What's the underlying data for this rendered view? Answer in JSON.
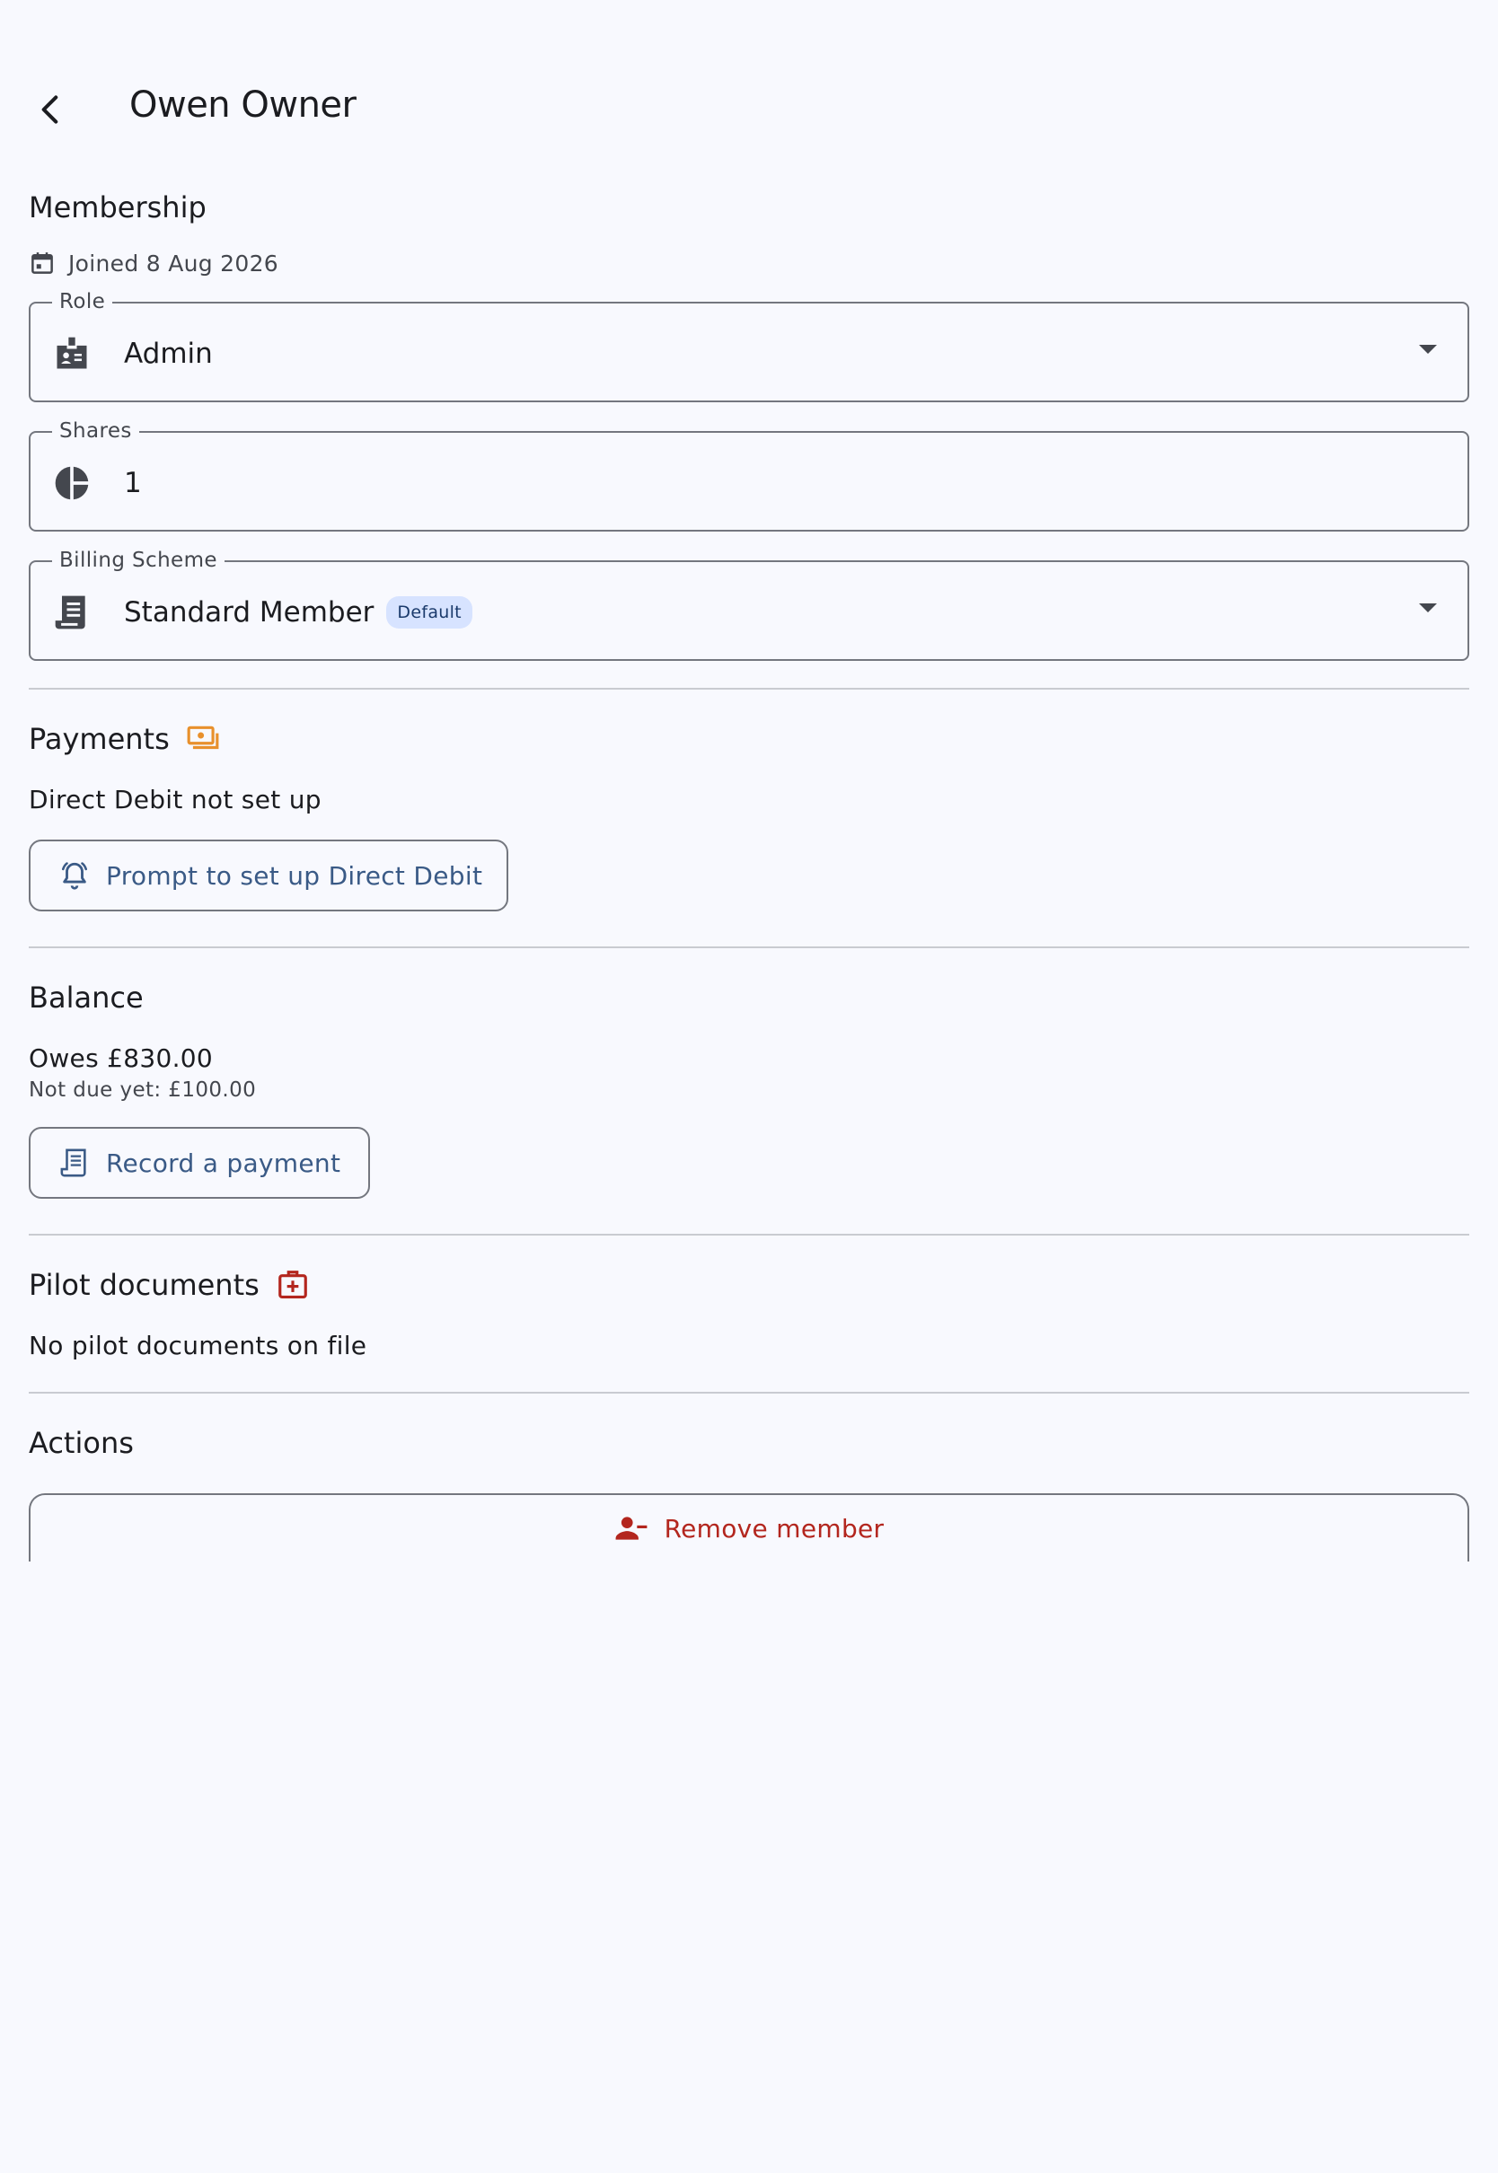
{
  "header": {
    "title": "Owen Owner",
    "back_icon": "arrow-back-icon"
  },
  "membership": {
    "title": "Membership",
    "joined": "Joined 8 Aug 2026",
    "role": {
      "label": "Role",
      "value": "Admin",
      "icon": "badge-icon"
    },
    "shares": {
      "label": "Shares",
      "value": "1",
      "icon": "pie-chart-icon"
    },
    "billing": {
      "label": "Billing Scheme",
      "value": "Standard Member",
      "badge": "Default",
      "icon": "receipt-icon"
    }
  },
  "payments": {
    "title": "Payments",
    "title_icon": "payments-icon",
    "status": "Direct Debit not set up",
    "prompt_button": "Prompt to set up Direct Debit",
    "accent_color": "#e8902c"
  },
  "balance": {
    "title": "Balance",
    "owes": "Owes £830.00",
    "not_due": "Not due yet: £100.00",
    "record_button": "Record a payment"
  },
  "pilot_documents": {
    "title": "Pilot documents",
    "title_icon": "medical-case-icon",
    "status": "No pilot documents on file",
    "accent_color": "#b3261e"
  },
  "actions": {
    "title": "Actions",
    "remove_button": "Remove member",
    "danger_color": "#b3261e"
  },
  "colors": {
    "background": "#f8f9fe",
    "primary": "#3a5a86",
    "outline": "#74777f",
    "badge_bg": "#d7e3ff"
  }
}
